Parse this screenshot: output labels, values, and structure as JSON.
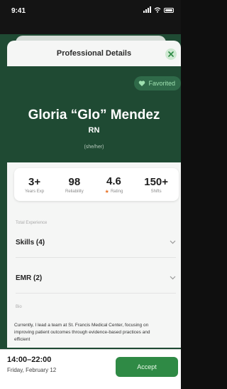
{
  "status_bar": {
    "time": "9:41"
  },
  "header": {
    "title": "Professional Details"
  },
  "profile": {
    "favorite_label": "Favorited",
    "name": "Gloria “Glo” Mendez",
    "credential": "RN",
    "pronouns": "(she/her)"
  },
  "stats": [
    {
      "value": "3+",
      "label": "Years Exp"
    },
    {
      "value": "98",
      "label": "Reliability"
    },
    {
      "value": "4.6",
      "label": "Rating",
      "icon": "star-icon"
    },
    {
      "value": "150+",
      "label": "Shifts"
    }
  ],
  "sections": {
    "label": "Total Experience",
    "skills": "Skills (4)",
    "emr": "EMR (2)",
    "bio_label": "Bio",
    "bio_text": "Currently, I lead a team at St. Francis Medical Center, focusing on improving patient outcomes through evidence-based practices and efficient"
  },
  "footer": {
    "time_range": "14:00–22:00",
    "date": "Friday, February 12",
    "accept_label": "Accept"
  },
  "colors": {
    "brand_green": "#1f4a33",
    "accent_green": "#2f8a45",
    "star": "#e8742a"
  }
}
